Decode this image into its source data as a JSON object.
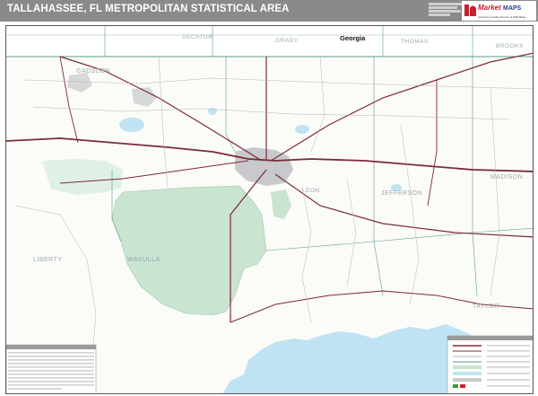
{
  "header": {
    "title": "TALLAHASSEE, FL METROPOLITAN STATISTICAL AREA",
    "logo_word": "Market",
    "logo_sub": "MAPS",
    "logo_tagline": "America's Leading Source of Wall Maps"
  },
  "map": {
    "state_label": "Georgia",
    "county_labels": {
      "decatur": "DECATUR",
      "grady": "GRADY",
      "thomas": "THOMAS",
      "brooks": "BROOKS",
      "gadsden": "GADSDEN",
      "leon": "LEON",
      "jefferson": "JEFFERSON",
      "madison": "MADISON",
      "liberty": "LIBERTY",
      "wakulla": "WAKULLA",
      "taylor": "TAYLOR"
    }
  },
  "colors": {
    "title_bar": "#8a8a8a",
    "water": "#bfe3f2",
    "forest": "#c9e4d0",
    "road": "#7b2b38",
    "county_line": "#5a9e8e",
    "urban": "#c7c9cc",
    "logo_red": "#c8202e"
  },
  "icons": [
    "market-maps-logo-icon"
  ]
}
